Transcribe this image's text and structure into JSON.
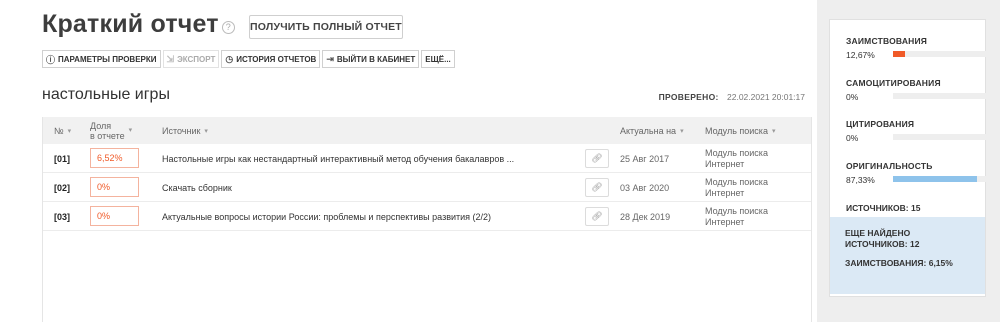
{
  "header": {
    "title": "Краткий отчет",
    "help_icon": "?",
    "full_report_button": "ПОЛУЧИТЬ ПОЛНЫЙ ОТЧЕТ"
  },
  "toolbar": {
    "params": "ПАРАМЕТРЫ ПРОВЕРКИ",
    "export": "ЭКСПОРТ",
    "history": "ИСТОРИЯ ОТЧЕТОВ",
    "exit": "ВЫЙТИ В КАБИНЕТ",
    "more": "ЕЩЁ..."
  },
  "document": {
    "subject": "настольные игры",
    "checked_label": "ПРОВЕРЕНО:",
    "checked_value": "22.02.2021 20:01:17"
  },
  "table": {
    "headers": {
      "num": "№",
      "share_line1": "Доля",
      "share_line2": "в отчете",
      "source": "Источник",
      "actual": "Актуальна на",
      "module": "Модуль поиска"
    },
    "rows": [
      {
        "num": "[01]",
        "share": "6,52%",
        "source": "Настольные игры как нестандартный интерактивный метод обучения бакалавров ...",
        "date": "25 Авг 2017",
        "module_line1": "Модуль поиска",
        "module_line2": "Интернет"
      },
      {
        "num": "[02]",
        "share": "0%",
        "source": "Скачать сборник",
        "date": "03 Авг 2020",
        "module_line1": "Модуль поиска",
        "module_line2": "Интернет"
      },
      {
        "num": "[03]",
        "share": "0%",
        "source": "Актуальные вопросы истории России: проблемы и перспективы развития (2/2)",
        "date": "28 Дек 2019",
        "module_line1": "Модуль поиска",
        "module_line2": "Интернет"
      }
    ]
  },
  "summary": {
    "borrowings_label": "ЗАИМСТВОВАНИЯ",
    "borrowings_value": "12,67%",
    "borrowings_fraction": 0.1267,
    "self_citation_label": "САМОЦИТИРОВАНИЯ",
    "self_citation_value": "0%",
    "self_citation_fraction": 0,
    "citation_label": "ЦИТИРОВАНИЯ",
    "citation_value": "0%",
    "citation_fraction": 0,
    "originality_label": "ОРИГИНАЛЬНОСТЬ",
    "originality_value": "87,33%",
    "originality_fraction": 0.8733,
    "sources_text": "ИСТОЧНИКОВ: 15",
    "more_found_text": "ЕЩЕ НАЙДЕНО ИСТОЧНИКОВ: 12",
    "more_borrowings_text": "ЗАИМСТВОВАНИЯ: 6,15%"
  },
  "colors": {
    "borrowings": "#f05a28",
    "originality": "#8ec3eb",
    "more_panel": "#dbe9f5"
  }
}
